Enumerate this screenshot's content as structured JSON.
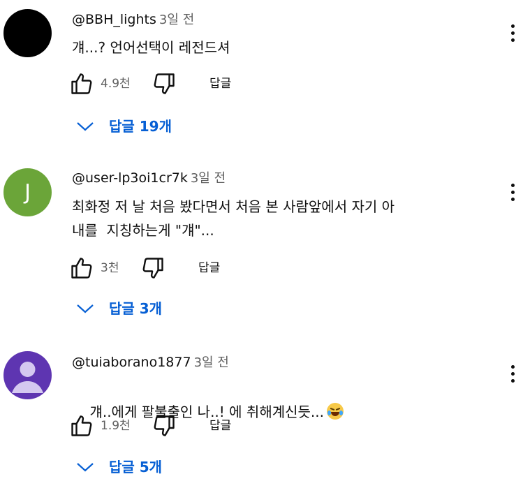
{
  "comments": [
    {
      "avatar_color": "#000000",
      "avatar_letter": "",
      "author": "@BBH_lights",
      "time": "3일 전",
      "text": "걔...? 언어선택이 레전드셔",
      "likes": "4.9천",
      "reply_label": "답글",
      "replies_label": "답글 19개"
    },
    {
      "avatar_color": "#6ba539",
      "avatar_letter": "J",
      "author": "@user-lp3oi1cr7k",
      "time": "3일 전",
      "text_line1": "최화정 저 날 처음 봤다면서 처음 본 사람앞에서 자기 아",
      "text_line2": "내를  지칭하는게 \"걔\"...",
      "likes": "3천",
      "reply_label": "답글",
      "replies_label": "답글 3개"
    },
    {
      "avatar_color": "#5e35b1",
      "avatar_letter": "",
      "author": "@tuiaborano1877",
      "time": "3일 전",
      "text": "걔..에게 팔불출인 나..! 에 취해계신듯...",
      "emoji": "face-with-tears-of-joy",
      "likes": "1.9천",
      "reply_label": "답글",
      "replies_label": "답글 5개"
    }
  ],
  "colors": {
    "link_blue": "#065fd4",
    "meta_gray": "#606060"
  }
}
